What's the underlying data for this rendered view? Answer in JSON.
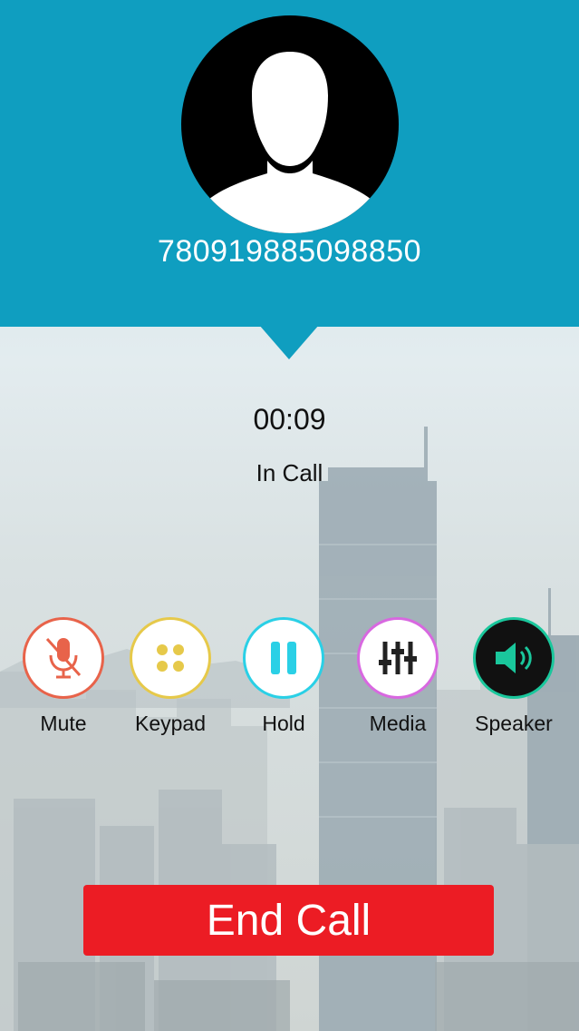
{
  "caller": {
    "number": "780919885098850"
  },
  "call": {
    "timer": "00:09",
    "status": "In Call"
  },
  "controls": [
    {
      "label": "Mute",
      "icon": "mic-off-icon",
      "color": "#e8634a"
    },
    {
      "label": "Keypad",
      "icon": "keypad-icon",
      "color": "#e6c94a"
    },
    {
      "label": "Hold",
      "icon": "pause-icon",
      "color": "#2ad0e6"
    },
    {
      "label": "Media",
      "icon": "equalizer-icon",
      "color": "#d868e0"
    },
    {
      "label": "Speaker",
      "icon": "speaker-icon",
      "color": "#1ac79c"
    }
  ],
  "end_call": {
    "label": "End Call",
    "color": "#ec1c24"
  },
  "theme": {
    "header_color": "#0f9ec0"
  }
}
